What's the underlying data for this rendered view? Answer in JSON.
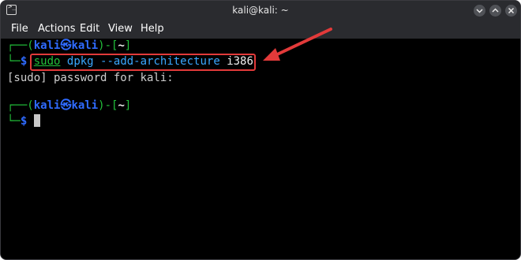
{
  "window": {
    "title": "kali@kali: ~"
  },
  "menubar": {
    "items": [
      "File",
      "Actions",
      "Edit",
      "View",
      "Help"
    ]
  },
  "terminal": {
    "prompt1": {
      "corner": "┌──(",
      "user": "kali",
      "at": "㉿",
      "host": "kali",
      "sep": ")-[",
      "dir": "~",
      "close": "]"
    },
    "line2": {
      "corner": "└─",
      "dollar": "$",
      "cmd": "sudo",
      "args": "dpkg --add-architecture",
      "num": "i386"
    },
    "sudo_prompt": "[sudo] password for kali:",
    "prompt2": {
      "corner": "┌──(",
      "user": "kali",
      "at": "㉿",
      "host": "kali",
      "sep": ")-[",
      "dir": "~",
      "close": "]"
    },
    "line4": {
      "corner": "└─",
      "dollar": "$"
    }
  },
  "colors": {
    "annotation": "#e23a3a",
    "prompt_green": "#22c23a",
    "prompt_blue": "#2f6bff"
  }
}
